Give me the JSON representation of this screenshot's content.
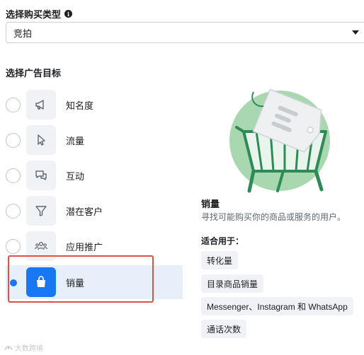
{
  "buy_type": {
    "label": "选择购买类型",
    "info_icon": "i",
    "selected": "竞拍"
  },
  "objective": {
    "label": "选择广告目标",
    "options": [
      {
        "label": "知名度",
        "icon": "megaphone-icon",
        "selected": false
      },
      {
        "label": "流量",
        "icon": "cursor-icon",
        "selected": false
      },
      {
        "label": "互动",
        "icon": "chat-bubbles-icon",
        "selected": false
      },
      {
        "label": "潜在客户",
        "icon": "filter-icon",
        "selected": false
      },
      {
        "label": "应用推广",
        "icon": "people-icon",
        "selected": false
      },
      {
        "label": "销量",
        "icon": "shopping-bag-icon",
        "selected": true
      }
    ]
  },
  "detail": {
    "title": "销量",
    "description": "寻找可能购买你的商品或服务的用户。",
    "fit_title": "适合用于：",
    "tags": [
      "转化量",
      "目录商品销量",
      "Messenger、Instagram 和 WhatsApp",
      "通话次数"
    ]
  },
  "watermark": "大数跨境",
  "colors": {
    "accent": "#1877f2",
    "selected_bg": "#e7f0fa",
    "highlight": "#e0523f",
    "illustration_green": "#2e8b57"
  }
}
